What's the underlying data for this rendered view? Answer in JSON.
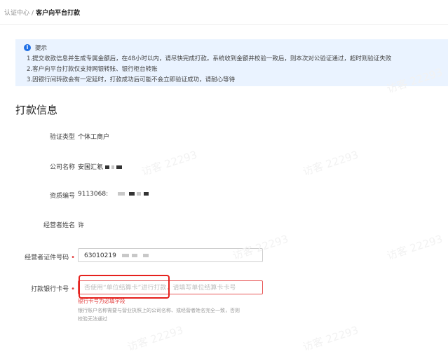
{
  "breadcrumb": {
    "root": "认证中心",
    "separator": "/",
    "current": "客户向平台打款"
  },
  "notice": {
    "title": "提示",
    "lines": [
      "1.提交收款信息并生成专属金额后，在48小时以内，请尽快完成打款。系统收到金额并校验一致后，则本次对公验证通过，超时则验证失败",
      "2.客户向平台打款仅支持网银转账、银行柜台转账",
      "3.因银行间转款会有一定延时，打款成功后可能不会立即验证成功，请耐心等待"
    ]
  },
  "section_title": "打款信息",
  "fields": {
    "verify_type": {
      "label": "验证类型",
      "value": "个体工商户"
    },
    "company_name": {
      "label": "公司名称",
      "value": "安国汇氡"
    },
    "license_no": {
      "label": "资质编号",
      "value": "9113068:"
    },
    "operator_name": {
      "label": "经营者姓名",
      "value": "许"
    },
    "operator_id": {
      "label": "经营者证件号码",
      "value": "63010219"
    },
    "bank_card": {
      "label": "打款银行卡号",
      "placeholder": "否使用“单位结算卡”进行打款，请填写单位结算卡卡号",
      "error": "银行卡号为必填字段",
      "hint_line1": "银行账户名称需要与营业执照上的公司名称、或经营者姓名完全一致，否则",
      "hint_line2": "校验无法通过"
    }
  },
  "watermark": "访客 22293",
  "colors": {
    "accent": "#1f6fe5",
    "notice_bg": "#eaf3ff",
    "required": "#e23c3c",
    "highlight_box": "#e5211d"
  }
}
